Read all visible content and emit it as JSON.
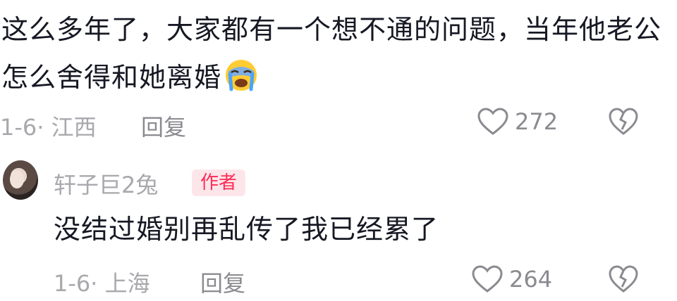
{
  "comment1": {
    "text": "这么多年了，大家都有一个想不通的问题，当年他老公怎么舍得和她离婚",
    "emoji": "loudly-crying-face-emoji",
    "date": "1-6",
    "location": "江西",
    "reply_label": "回复",
    "likes": "272"
  },
  "comment2": {
    "username": "轩子巨2兔",
    "badge": "作者",
    "text": "没结过婚别再乱传了我已经累了",
    "date": "1-6",
    "location": "上海",
    "reply_label": "回复",
    "likes": "264"
  },
  "colors": {
    "text": "#161823",
    "meta": "#a8a8ad",
    "badge_bg": "#fde6ea",
    "badge_text": "#fe2c55"
  },
  "icons": [
    "heart-icon",
    "broken-heart-icon",
    "avatar"
  ]
}
